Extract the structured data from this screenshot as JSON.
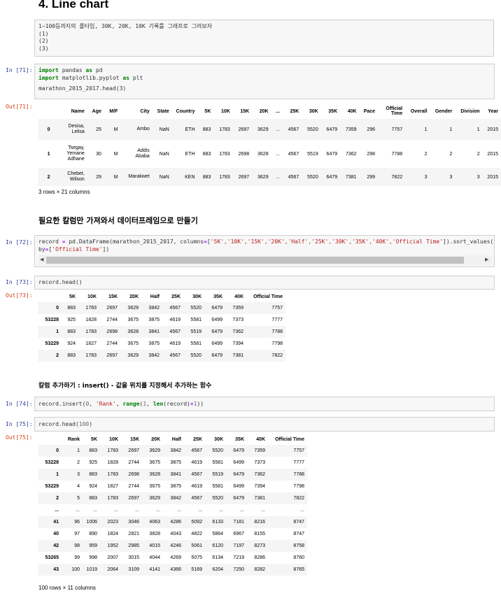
{
  "heading": "4. Line chart",
  "md_lines": [
    "1~100등까지의 풀타임, 30K, 20K, 10K 기록를 그래프로 그려보자",
    "(1)",
    "(2)",
    "(3)"
  ],
  "cells": {
    "c71": {
      "in_prompt": "In [71]:",
      "out_prompt": "Out[71]:",
      "code": {
        "l1_kw1": "import",
        "l1_rest": " pandas ",
        "l1_kw2": "as",
        "l1_tail": " pd",
        "l2_kw1": "import",
        "l2_rest": " matplotlib.pyplot ",
        "l2_kw2": "as",
        "l2_tail": " plt",
        "l3": "marathon_2015_2017.head(3)"
      },
      "table": {
        "headers": [
          "",
          "Name",
          "Age",
          "M/F",
          "City",
          "State",
          "Country",
          "5K",
          "10K",
          "15K",
          "20K",
          "...",
          "25K",
          "30K",
          "35K",
          "40K",
          "Pace",
          "Official Time",
          "Overall",
          "Gender",
          "Division",
          "Year"
        ],
        "rows": [
          [
            "0",
            "Desisa, Lelisa",
            "25",
            "M",
            "Ambo",
            "NaN",
            "ETH",
            "883",
            "1783",
            "2697",
            "3629",
            "...",
            "4567",
            "5520",
            "6479",
            "7359",
            "296",
            "7757",
            "1",
            "1",
            "1",
            "2015"
          ],
          [
            "1",
            "Tsegay, Yemane Adhane",
            "30",
            "M",
            "Addis Ababa",
            "NaN",
            "ETH",
            "883",
            "1783",
            "2698",
            "3628",
            "...",
            "4567",
            "5519",
            "6479",
            "7362",
            "298",
            "7788",
            "2",
            "2",
            "2",
            "2015"
          ],
          [
            "2",
            "Chebet, Wilson",
            "29",
            "M",
            "Marakwet",
            "NaN",
            "KEN",
            "883",
            "1783",
            "2697",
            "3629",
            "...",
            "4567",
            "5520",
            "6479",
            "7381",
            "299",
            "7822",
            "3",
            "3",
            "3",
            "2015"
          ]
        ],
        "caption": "3 rows × 21 columns"
      }
    },
    "section1": "필요한 칼럼만 가져와서 데이터프레임으로 만들기",
    "c72": {
      "in_prompt": "In [72]:",
      "l1_a": "record ",
      "l1_op": "=",
      "l1_b": " pd.DataFrame(marathon_2015_2017, columns",
      "l1_op2": "=",
      "l1_c": "[",
      "l1_strs": "'5K','10K','15K','20K','Half','25K','30K','35K','40K','Official Time'",
      "l1_d": "]).sort_values(",
      "l2_a": "by",
      "l2_op": "=",
      "l2_b": "[",
      "l2_str": "'Official Time'",
      "l2_c": "])"
    },
    "c73": {
      "in_prompt": "In [73]:",
      "out_prompt": "Out[73]:",
      "code": "record.head()",
      "table": {
        "headers": [
          "",
          "5K",
          "10K",
          "15K",
          "20K",
          "Half",
          "25K",
          "30K",
          "35K",
          "40K",
          "Official Time"
        ],
        "rows": [
          [
            "0",
            "883",
            "1783",
            "2697",
            "3629",
            "3842",
            "4567",
            "5520",
            "6479",
            "7359",
            "7757"
          ],
          [
            "53228",
            "925",
            "1828",
            "2744",
            "3675",
            "3875",
            "4619",
            "5581",
            "6499",
            "7373",
            "7777"
          ],
          [
            "1",
            "883",
            "1783",
            "2698",
            "3628",
            "3841",
            "4567",
            "5519",
            "6479",
            "7362",
            "7788"
          ],
          [
            "53229",
            "924",
            "1827",
            "2744",
            "3675",
            "3875",
            "4619",
            "5581",
            "6499",
            "7394",
            "7798"
          ],
          [
            "2",
            "883",
            "1783",
            "2697",
            "3629",
            "3842",
            "4567",
            "5520",
            "6479",
            "7381",
            "7822"
          ]
        ]
      }
    },
    "section2": "칼럼 추가하기 : insert() - 값을 위치를 지정해서 추가하는 함수",
    "c74": {
      "in_prompt": "In [74]:",
      "a": "record.insert(",
      "n0": "0",
      "b": ", ",
      "s": "'Rank'",
      "c": ", ",
      "f": "range",
      "d": "(",
      "n1": "1",
      "e": ", ",
      "g": "len",
      "h": "(record)",
      "op": "+",
      "n2": "1",
      "i": "))"
    },
    "c75": {
      "in_prompt": "In [75]:",
      "out_prompt": "Out[75]:",
      "a": "record.head(",
      "n": "100",
      "b": ")",
      "table": {
        "headers": [
          "",
          "Rank",
          "5K",
          "10K",
          "15K",
          "20K",
          "Half",
          "25K",
          "30K",
          "35K",
          "40K",
          "Official Time"
        ],
        "rows": [
          [
            "0",
            "1",
            "883",
            "1783",
            "2697",
            "3629",
            "3842",
            "4567",
            "5520",
            "6479",
            "7359",
            "7757"
          ],
          [
            "53228",
            "2",
            "925",
            "1828",
            "2744",
            "3675",
            "3875",
            "4619",
            "5581",
            "6499",
            "7373",
            "7777"
          ],
          [
            "1",
            "3",
            "883",
            "1783",
            "2698",
            "3628",
            "3841",
            "4567",
            "5519",
            "6479",
            "7362",
            "7788"
          ],
          [
            "53229",
            "4",
            "924",
            "1827",
            "2744",
            "3675",
            "3875",
            "4619",
            "5581",
            "6499",
            "7394",
            "7798"
          ],
          [
            "2",
            "5",
            "883",
            "1783",
            "2697",
            "3629",
            "3842",
            "4567",
            "5520",
            "6479",
            "7381",
            "7822"
          ],
          [
            "...",
            "...",
            "...",
            "...",
            "...",
            "...",
            "...",
            "...",
            "...",
            "...",
            "...",
            "..."
          ],
          [
            "41",
            "96",
            "1006",
            "2023",
            "3046",
            "4063",
            "4286",
            "5092",
            "6133",
            "7181",
            "8216",
            "8747"
          ],
          [
            "40",
            "97",
            "890",
            "1824",
            "2821",
            "3828",
            "4043",
            "4822",
            "5864",
            "6967",
            "8155",
            "8747"
          ],
          [
            "42",
            "98",
            "959",
            "1952",
            "2985",
            "4015",
            "4246",
            "5061",
            "6120",
            "7197",
            "8273",
            "8758"
          ],
          [
            "53265",
            "99",
            "998",
            "2007",
            "3015",
            "4044",
            "4269",
            "5075",
            "6134",
            "7219",
            "8286",
            "8760"
          ],
          [
            "43",
            "100",
            "1019",
            "2064",
            "3109",
            "4141",
            "4366",
            "5169",
            "6204",
            "7250",
            "8282",
            "8765"
          ]
        ],
        "caption": "100 rows × 11 columns"
      }
    }
  }
}
